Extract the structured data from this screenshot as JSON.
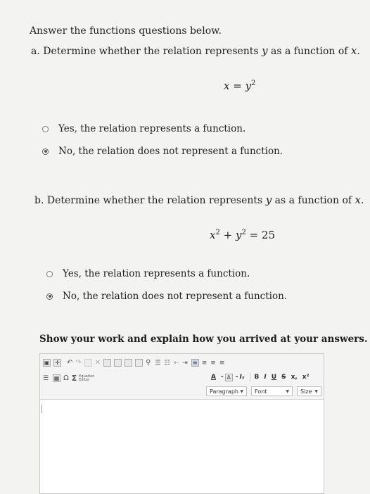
{
  "header": {
    "instructions": "Answer the functions questions below."
  },
  "part_a": {
    "prompt_pre": "a. Determine whether the relation represents ",
    "prompt_var1": "y",
    "prompt_mid": " as a function of ",
    "prompt_var2": "x",
    "prompt_end": ".",
    "equation_lhs": "x = y",
    "equation_exp": "2",
    "options": [
      {
        "label": "Yes, the relation represents a function.",
        "selected": false
      },
      {
        "label": "No, the relation does not represent a function.",
        "selected": true
      }
    ]
  },
  "part_b": {
    "prompt_pre": "b. Determine whether the relation represents ",
    "prompt_var1": "y",
    "prompt_mid": " as a function of ",
    "prompt_var2": "x",
    "prompt_end": ".",
    "eq_x": "x",
    "eq_exp1": "2",
    "eq_plus": " + y",
    "eq_exp2": "2",
    "eq_rhs": " = 25",
    "options": [
      {
        "label": "Yes, the relation represents a function.",
        "selected": false
      },
      {
        "label": "No, the relation does not represent a function.",
        "selected": true
      }
    ]
  },
  "work": {
    "prompt": "Show your work and explain how you arrived at your answers."
  },
  "editor": {
    "equation_editor_label": "Equation Editor",
    "omega": "Ω",
    "sigma": "Σ",
    "bold": "B",
    "italic": "I",
    "underline": "U",
    "strike": "S",
    "subscript": "x,",
    "superscript": "x²",
    "font_color": "A",
    "clear_format": "Iₓ",
    "paragraph": "Paragraph",
    "font": "Font",
    "size": "Size"
  }
}
